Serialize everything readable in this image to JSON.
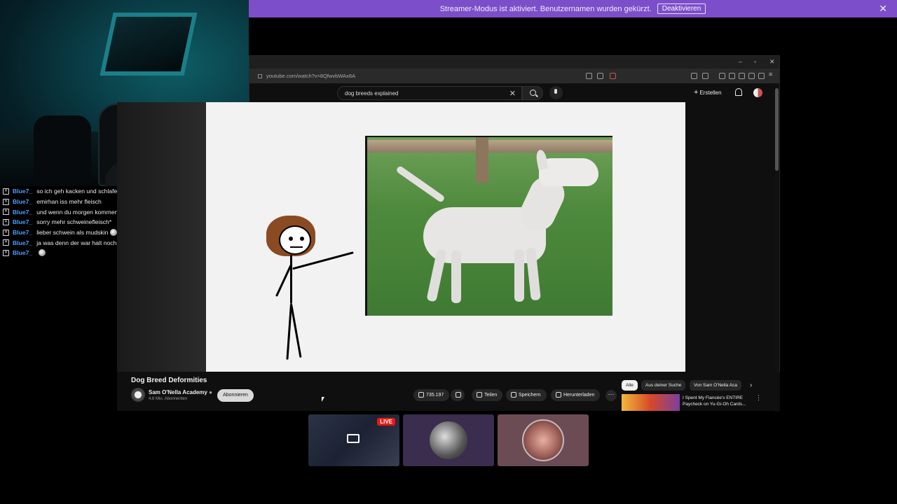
{
  "banner": {
    "text": "Streamer-Modus ist aktiviert. Benutzernamen wurden gekürzt.",
    "button": "Deaktivieren"
  },
  "chat": [
    {
      "user": "Blue7_",
      "text": "so ich geh kacken und schlafen",
      "emote": false
    },
    {
      "user": "Blue7_",
      "text": "emirhan iss mehr fleisch",
      "emote": false
    },
    {
      "user": "Blue7_",
      "text": "und wenn du morgen kommen solltest, kriegst platzverbot",
      "emote": false
    },
    {
      "user": "Blue7_",
      "text": "sorry mehr schweinefleisch*",
      "emote": false
    },
    {
      "user": "Blue7_",
      "text": "lieber schwein als mudskin",
      "emote": true
    },
    {
      "user": "Blue7_",
      "text": "ja was denn der war halt noch nicht duschen nach baustelle",
      "emote": false
    },
    {
      "user": "Blue7_",
      "text": "",
      "emote": true
    }
  ],
  "browser": {
    "url": "youtube.com/watch?v=8QfwvbWAx8A",
    "search_value": "dog breeds explained",
    "create_label": "Erstellen"
  },
  "video": {
    "title": "Dog Breed Deformities",
    "channel": "Sam O'Nella Academy",
    "subscribers": "4,6 Mio. Abonnenten",
    "subscribe_label": "Abonnieren",
    "likes": "735.197",
    "share_label": "Teilen",
    "save_label": "Speichern",
    "download_label": "Herunterladen"
  },
  "chips": [
    "Alle",
    "Aus deiner Suche",
    "Von Sam O'Nella Aca"
  ],
  "recommendation": {
    "title": "I Spent My Fiancée's ENTIRE Paycheck on Yu-Gi-Oh Cards..."
  },
  "thumbnails": {
    "live_label": "LIVE"
  }
}
